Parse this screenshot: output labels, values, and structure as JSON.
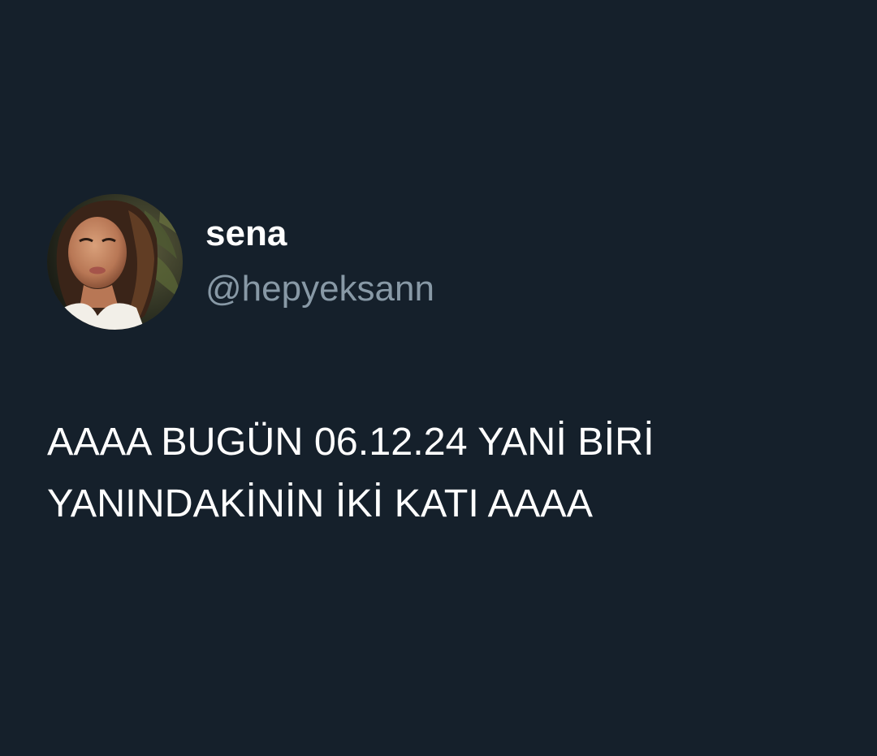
{
  "tweet": {
    "author": {
      "display_name": "sena",
      "handle": "@hepyeksann",
      "avatar_icon": "profile-photo"
    },
    "text_lines": [
      "AAAA BUGÜN 06.12.24 YANİ BİRİ",
      "YANINDAKİNİN İKİ KATI AAAA"
    ]
  },
  "colors": {
    "background": "#15202b",
    "name": "#ffffff",
    "handle": "#8899a6",
    "text": "#ffffff"
  }
}
